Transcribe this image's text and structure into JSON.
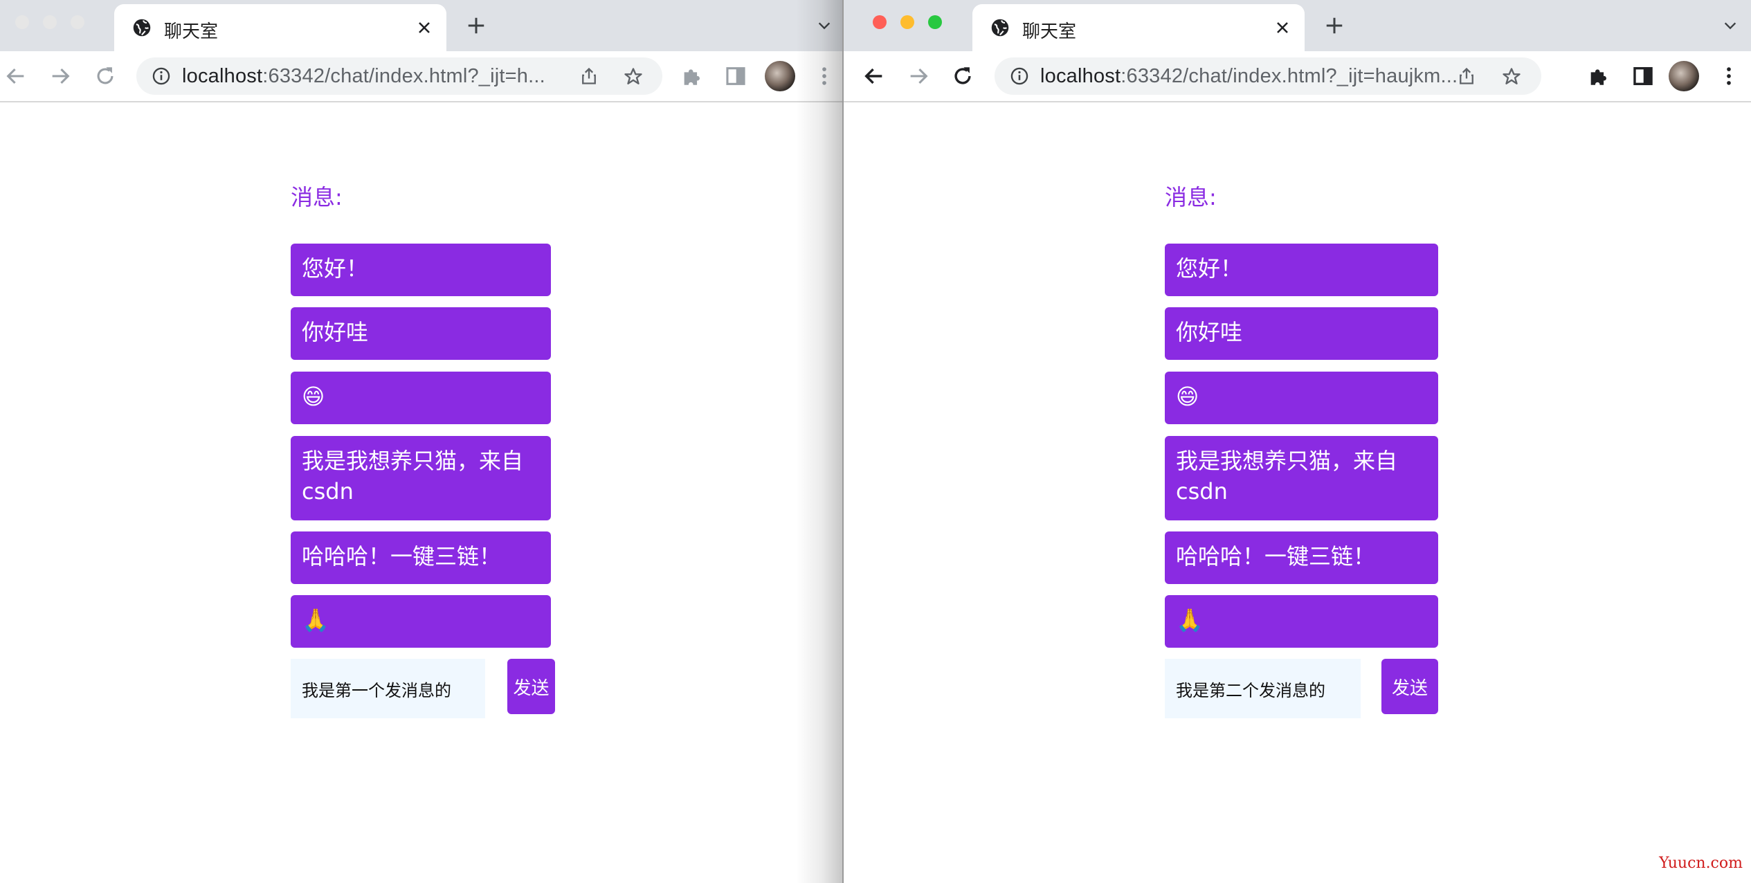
{
  "browsers": [
    {
      "id": "left",
      "tab_title": "聊天室",
      "url_host": "localhost",
      "url_rest": ":63342/chat/index.html?_ijt=h...",
      "chat": {
        "title": "消息:",
        "messages": [
          "您好！",
          "你好哇",
          "😄",
          "我是我想养只猫，来自csdn",
          "哈哈哈！一键三链！",
          "🙏"
        ],
        "input_value": "我是第一个发消息的",
        "send_label": "发送"
      }
    },
    {
      "id": "right",
      "tab_title": "聊天室",
      "url_host": "localhost",
      "url_rest": ":63342/chat/index.html?_ijt=haujkm...",
      "chat": {
        "title": "消息:",
        "messages": [
          "您好！",
          "你好哇",
          "😄",
          "我是我想养只猫，来自csdn",
          "哈哈哈！一键三链！",
          "🙏"
        ],
        "input_value": "我是第二个发消息的",
        "send_label": "发送"
      }
    }
  ],
  "colors": {
    "accent": "#8a2be2",
    "input_bg": "#f0f8ff",
    "tabstrip_bg": "#dee1e6",
    "traffic_red": "#ff5f57",
    "traffic_yellow": "#febc2e",
    "traffic_green": "#28c840"
  },
  "icons": [
    "globe-icon",
    "close-icon",
    "plus-icon",
    "chevron-down-icon",
    "back-arrow-icon",
    "forward-arrow-icon",
    "reload-icon",
    "info-icon",
    "share-icon",
    "star-icon",
    "puzzle-icon",
    "side-panel-icon",
    "avatar",
    "kebab-menu-icon"
  ],
  "watermark": "Yuucn.com"
}
